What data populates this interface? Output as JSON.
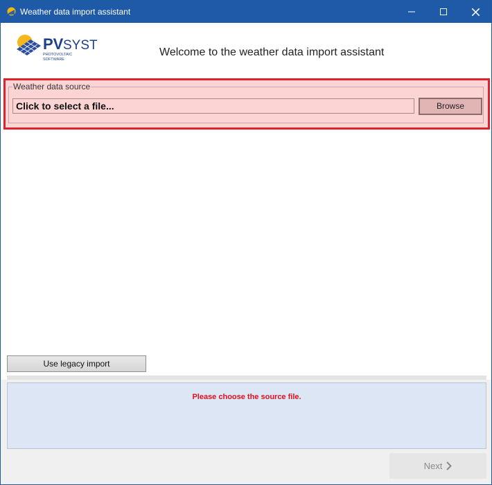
{
  "window": {
    "title": "Weather data import assistant"
  },
  "header": {
    "logo_text_pv": "PV",
    "logo_text_syst": "SYST",
    "logo_sub1": "PHOTOVOLTAIC",
    "logo_sub2": "SOFTWARE",
    "welcome": "Welcome to the weather data import assistant"
  },
  "source": {
    "group_label": "Weather data source",
    "file_field_value": "Click to select a file...",
    "browse_label": "Browse"
  },
  "footer": {
    "legacy_label": "Use legacy import",
    "message": "Please choose the source file.",
    "next_label": "Next"
  },
  "colors": {
    "titlebar": "#1e5aa7",
    "highlight_border": "#e0222a",
    "highlight_fill": "#fcd4d4",
    "message_text": "#e0101e",
    "message_panel": "#dde6f5"
  }
}
